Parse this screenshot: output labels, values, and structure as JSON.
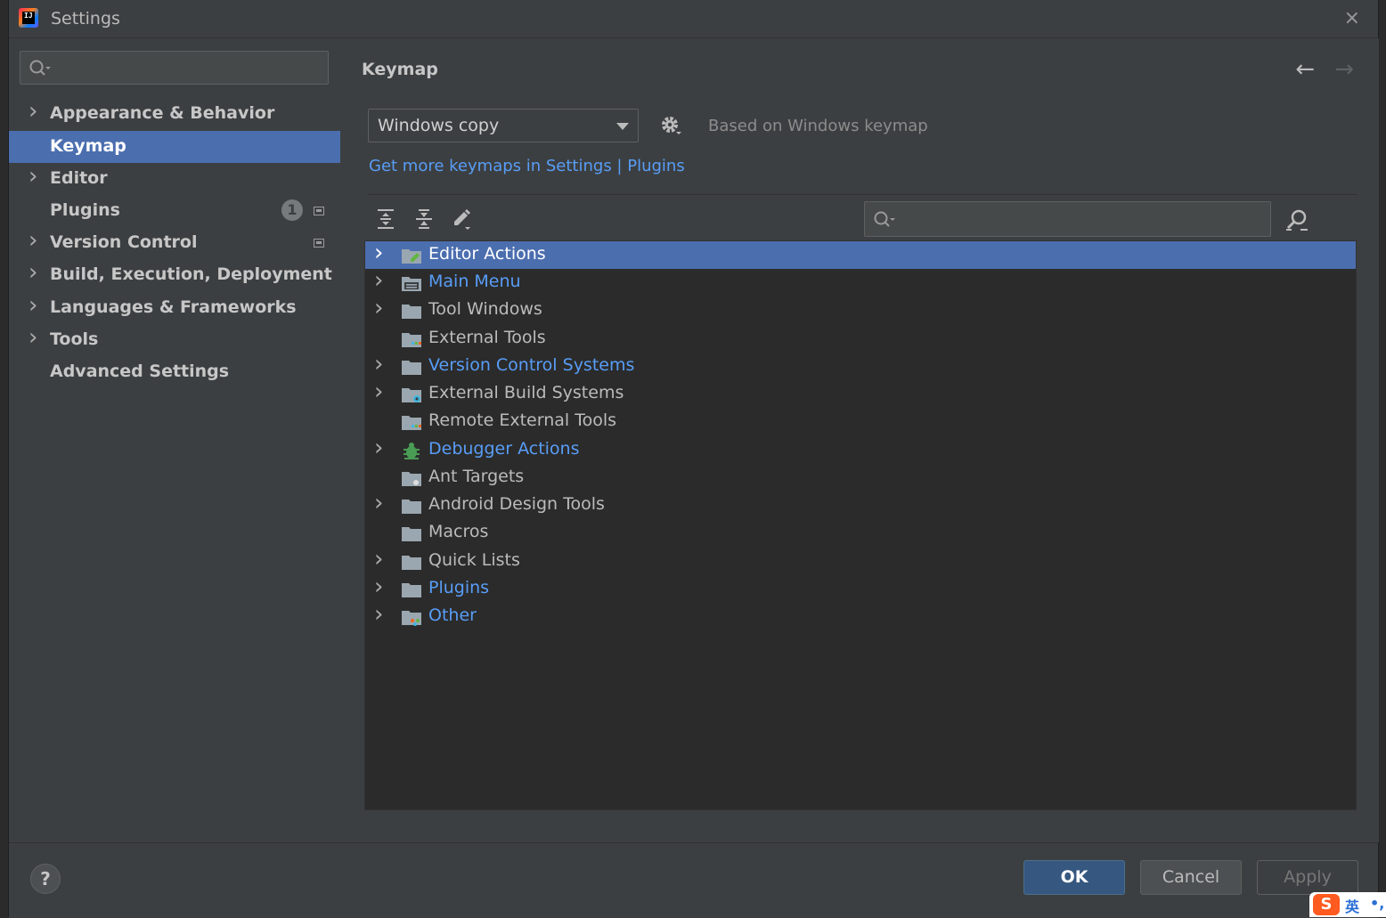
{
  "window": {
    "title": "Settings",
    "close_icon": "×"
  },
  "sidebar": {
    "search_placeholder": "",
    "items": [
      {
        "label": "Appearance & Behavior",
        "expandable": true
      },
      {
        "label": "Keymap",
        "expandable": false,
        "selected": true
      },
      {
        "label": "Editor",
        "expandable": true
      },
      {
        "label": "Plugins",
        "expandable": false,
        "badge": "1"
      },
      {
        "label": "Version Control",
        "expandable": true
      },
      {
        "label": "Build, Execution, Deployment",
        "expandable": true
      },
      {
        "label": "Languages & Frameworks",
        "expandable": true
      },
      {
        "label": "Tools",
        "expandable": true
      },
      {
        "label": "Advanced Settings",
        "expandable": false
      }
    ]
  },
  "content": {
    "title": "Keymap",
    "back_icon": "←",
    "forward_icon": "→",
    "keymap_value": "Windows copy",
    "based_on": "Based on Windows keymap",
    "plugins_link": "Get more keymaps in Settings | Plugins",
    "tree_search_placeholder": ""
  },
  "tree": {
    "rows": [
      {
        "label": "Editor Actions",
        "expandable": true,
        "selected": true,
        "blue": false,
        "icon": "folder-edit-icon"
      },
      {
        "label": "Main Menu",
        "expandable": true,
        "blue": true,
        "icon": "folder-menu-icon"
      },
      {
        "label": "Tool Windows",
        "expandable": true,
        "blue": false,
        "icon": "folder-icon"
      },
      {
        "label": "External Tools",
        "expandable": false,
        "blue": false,
        "icon": "folder-tools-icon"
      },
      {
        "label": "Version Control Systems",
        "expandable": true,
        "blue": true,
        "icon": "folder-icon"
      },
      {
        "label": "External Build Systems",
        "expandable": true,
        "blue": false,
        "icon": "folder-gear-icon"
      },
      {
        "label": "Remote External Tools",
        "expandable": false,
        "blue": false,
        "icon": "folder-tools-icon"
      },
      {
        "label": "Debugger Actions",
        "expandable": true,
        "blue": true,
        "icon": "bug-icon"
      },
      {
        "label": "Ant Targets",
        "expandable": false,
        "blue": false,
        "icon": "folder-ant-icon"
      },
      {
        "label": "Android Design Tools",
        "expandable": true,
        "blue": false,
        "icon": "folder-icon"
      },
      {
        "label": "Macros",
        "expandable": false,
        "blue": false,
        "icon": "folder-icon"
      },
      {
        "label": "Quick Lists",
        "expandable": true,
        "blue": false,
        "icon": "folder-icon"
      },
      {
        "label": "Plugins",
        "expandable": true,
        "blue": true,
        "icon": "folder-icon"
      },
      {
        "label": "Other",
        "expandable": true,
        "blue": true,
        "icon": "folder-other-icon"
      }
    ]
  },
  "footer": {
    "help_label": "?",
    "ok_label": "OK",
    "cancel_label": "Cancel",
    "apply_label": "Apply"
  },
  "ime": {
    "logo": "S",
    "lang": "英",
    "punct": "•,"
  },
  "colors": {
    "selection": "#4b6eaf",
    "link": "#589df6",
    "background": "#3c3f41",
    "tree_background": "#2b2b2b"
  }
}
